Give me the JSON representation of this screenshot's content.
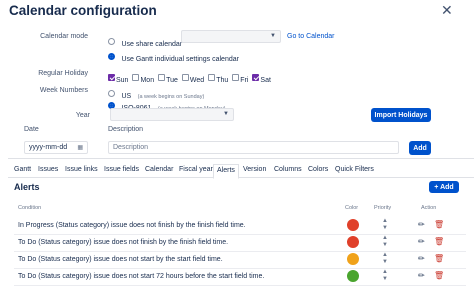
{
  "dialog": {
    "title": "Calendar configuration",
    "close_glyph": "✕"
  },
  "calendar_mode": {
    "label": "Calendar mode",
    "option_share": "Use share calendar",
    "option_gantt": "Use Gantt individual settings calendar",
    "select_value": "",
    "go_link": "Go to Calendar"
  },
  "regular_holiday": {
    "label": "Regular Holiday",
    "days": [
      {
        "label": "Sun",
        "checked": true
      },
      {
        "label": "Mon",
        "checked": false
      },
      {
        "label": "Tue",
        "checked": false
      },
      {
        "label": "Wed",
        "checked": false
      },
      {
        "label": "Thu",
        "checked": false
      },
      {
        "label": "Fri",
        "checked": false
      },
      {
        "label": "Sat",
        "checked": true
      }
    ]
  },
  "week_numbers": {
    "label": "Week Numbers",
    "us": "US",
    "us_note": "(a week begins on Sunday)",
    "iso": "ISO-8061",
    "iso_note": "(a week begins on Monday)"
  },
  "year": {
    "label": "Year",
    "select_value": "",
    "import_button": "Import Holidays"
  },
  "date_desc": {
    "date_label": "Date",
    "desc_label": "Description",
    "date_placeholder": "yyyy-mm-dd",
    "desc_placeholder": "Description",
    "add_button": "Add"
  },
  "tabs": [
    "Gantt",
    "Issues",
    "Issue links",
    "Issue fields",
    "Calendar",
    "Fiscal year",
    "Alerts",
    "Version",
    "Columns",
    "Colors",
    "Quick Filters"
  ],
  "active_tab": "Alerts",
  "alerts": {
    "title": "Alerts",
    "add_button": "+ Add",
    "headers": {
      "condition": "Condition",
      "color": "Color",
      "priority": "Priority",
      "action": "Action"
    },
    "rows": [
      {
        "condition": "In Progress (Status category) issue does not finish by the finish field time.",
        "color": "#e0402a"
      },
      {
        "condition": "To Do (Status category) issue does not finish by the finish field time.",
        "color": "#e0402a"
      },
      {
        "condition": "To Do (Status category) issue does not start by the start field time.",
        "color": "#f0a21a"
      },
      {
        "condition": "To Do (Status category) issue does not start 72 hours before the start field time.",
        "color": "#4aa52e"
      }
    ]
  },
  "icons": {
    "edit": "pencil-icon",
    "delete": "trash-icon",
    "calendar": "calendar-icon"
  },
  "colors": {
    "primary": "#0052cc",
    "checkbox": "#6c2ca8"
  }
}
